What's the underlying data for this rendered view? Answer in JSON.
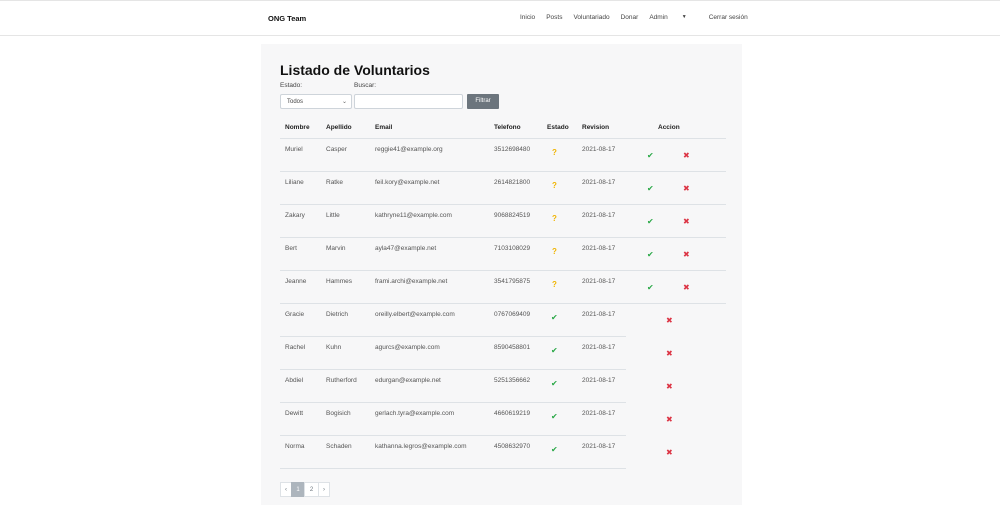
{
  "nav": {
    "brand": "ONG Team",
    "links": [
      "Inicio",
      "Posts",
      "Voluntariado",
      "Donar",
      "Admin",
      "Cerrar sesión"
    ]
  },
  "page": {
    "title": "Listado de Voluntarios",
    "estado_label": "Estado:",
    "buscar_label": "Buscar:",
    "estado_selected": "Todos",
    "search_value": "",
    "filter_button": "Filtrar"
  },
  "table": {
    "headers": [
      "Nombre",
      "Apellido",
      "Email",
      "Telefono",
      "Estado",
      "Revision",
      "Accion"
    ],
    "rows": [
      {
        "nombre": "Muriel",
        "apellido": "Casper",
        "email": "reggie41@example.org",
        "telefono": "3512698480",
        "estado": "pending",
        "revision": "2021-08-17"
      },
      {
        "nombre": "Liliane",
        "apellido": "Ratke",
        "email": "feil.kory@example.net",
        "telefono": "2614821800",
        "estado": "pending",
        "revision": "2021-08-17"
      },
      {
        "nombre": "Zakary",
        "apellido": "Little",
        "email": "kathryne11@example.com",
        "telefono": "9068824519",
        "estado": "pending",
        "revision": "2021-08-17"
      },
      {
        "nombre": "Bert",
        "apellido": "Marvin",
        "email": "ayla47@example.net",
        "telefono": "7103108029",
        "estado": "pending",
        "revision": "2021-08-17"
      },
      {
        "nombre": "Jeanne",
        "apellido": "Hammes",
        "email": "frami.archi@example.net",
        "telefono": "3541795875",
        "estado": "pending",
        "revision": "2021-08-17"
      },
      {
        "nombre": "Gracie",
        "apellido": "Dietrich",
        "email": "oreilly.elbert@example.com",
        "telefono": "0767069409",
        "estado": "approved",
        "revision": "2021-08-17"
      },
      {
        "nombre": "Rachel",
        "apellido": "Kuhn",
        "email": "agurcs@example.com",
        "telefono": "8590458801",
        "estado": "approved",
        "revision": "2021-08-17"
      },
      {
        "nombre": "Abdiel",
        "apellido": "Rutherford",
        "email": "edurgan@example.net",
        "telefono": "5251356662",
        "estado": "approved",
        "revision": "2021-08-17"
      },
      {
        "nombre": "Dewitt",
        "apellido": "Bogisich",
        "email": "gerlach.tyra@example.com",
        "telefono": "4660619219",
        "estado": "approved",
        "revision": "2021-08-17"
      },
      {
        "nombre": "Norma",
        "apellido": "Schaden",
        "email": "kathanna.legros@example.com",
        "telefono": "4508632970",
        "estado": "approved",
        "revision": "2021-08-17"
      }
    ]
  },
  "pagination": {
    "prev": "‹",
    "pages": [
      "1",
      "2"
    ],
    "next": "›",
    "current": "1"
  },
  "icons": {
    "pending": "question-icon",
    "approved": "check-icon",
    "approve_action": "check-icon",
    "reject_action": "close-icon"
  },
  "colors": {
    "approve": "#28a745",
    "reject": "#dc3545",
    "pending": "#f0b400",
    "filter_button": "#6c757d"
  }
}
